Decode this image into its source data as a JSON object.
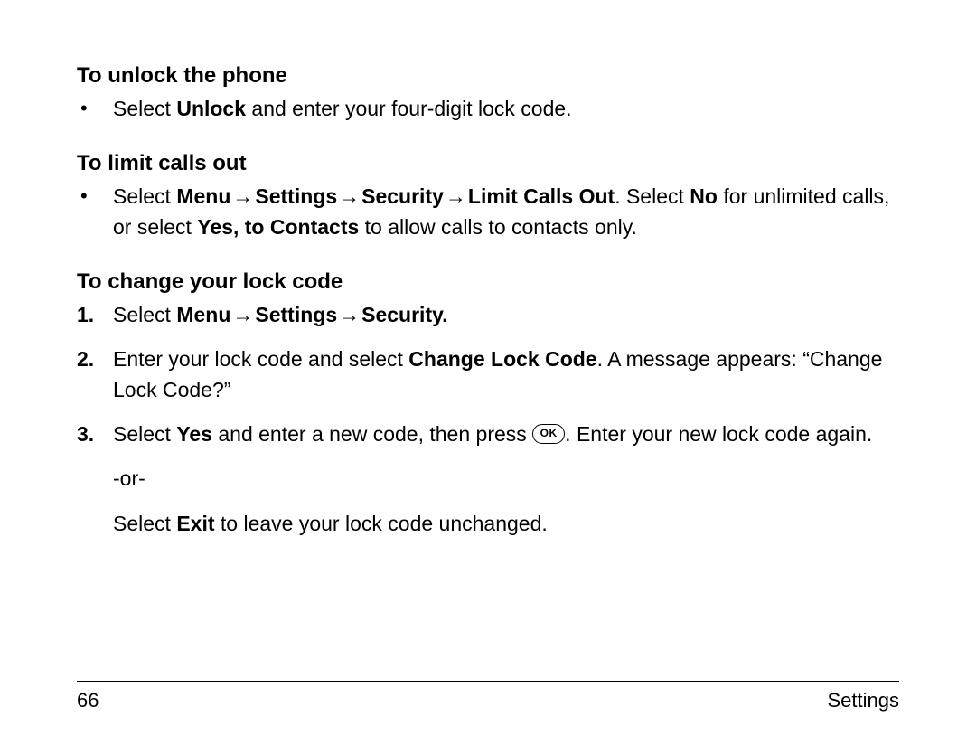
{
  "section1": {
    "heading": "To unlock the phone",
    "bullet": {
      "pre": "Select ",
      "bold": "Unlock",
      "post": " and enter your four-digit lock code."
    }
  },
  "section2": {
    "heading": "To limit calls out",
    "bullet": {
      "t1": "Select ",
      "m": "Menu",
      "arrow": " → ",
      "s": "Settings",
      "sec": "Security",
      "lco": "Limit Calls Out",
      "t2": ". Select ",
      "no": "No",
      "t3": " for unlimited calls, or select ",
      "ytc": "Yes, to Contacts",
      "t4": " to allow calls to contacts only."
    }
  },
  "section3": {
    "heading": "To change your lock code",
    "step1": {
      "num": "1.",
      "t1": "Select ",
      "m": "Menu",
      "arrow": " → ",
      "s": "Settings",
      "sec": "Security.",
      "t2": ""
    },
    "step2": {
      "num": "2.",
      "t1": "Enter your lock code and select ",
      "clc": "Change Lock Code",
      "t2": ". A message appears: “Change Lock Code?”"
    },
    "step3": {
      "num": "3.",
      "t1": "Select ",
      "yes": "Yes",
      "t2": " and enter a new code, then press ",
      "ok": "OK",
      "t3": ". Enter your new lock code again."
    },
    "or": "-or-",
    "alt": {
      "t1": "Select ",
      "exit": "Exit",
      "t2": " to leave your lock code unchanged."
    }
  },
  "footer": {
    "page": "66",
    "title": "Settings"
  }
}
